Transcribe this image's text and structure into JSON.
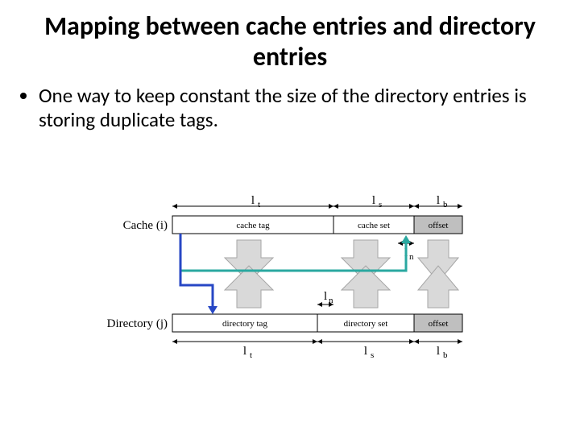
{
  "title": "Mapping between cache entries and directory entries",
  "bullet1": "One way to keep constant the size of the directory entries is storing duplicate tags.",
  "diagram": {
    "row_labels": {
      "cache": "Cache (i)",
      "directory": "Directory (j)"
    },
    "cache_fields": {
      "tag": "cache tag",
      "set": "cache set",
      "offset": "offset"
    },
    "directory_fields": {
      "tag": "directory tag",
      "set": "directory set",
      "offset": "offset"
    },
    "top_widths": {
      "lt": "lₜ",
      "ls": "lₛ",
      "lb": "l_b"
    },
    "bottom_widths": {
      "lt": "lₜ",
      "ls": "lₛ",
      "lb": "l_b"
    },
    "ln_marker_top": "lₙ",
    "ln_marker_bottom": "lₙ",
    "arrows": {
      "between_tag": "bidirectional-vertical",
      "between_set": "bidirectional-vertical",
      "between_offset": "bidirectional-vertical",
      "teal_arrow": "cache-row-to-directory-set (teal)",
      "blue_arrow": "cache-row-to-directory-tag (blue)"
    }
  }
}
